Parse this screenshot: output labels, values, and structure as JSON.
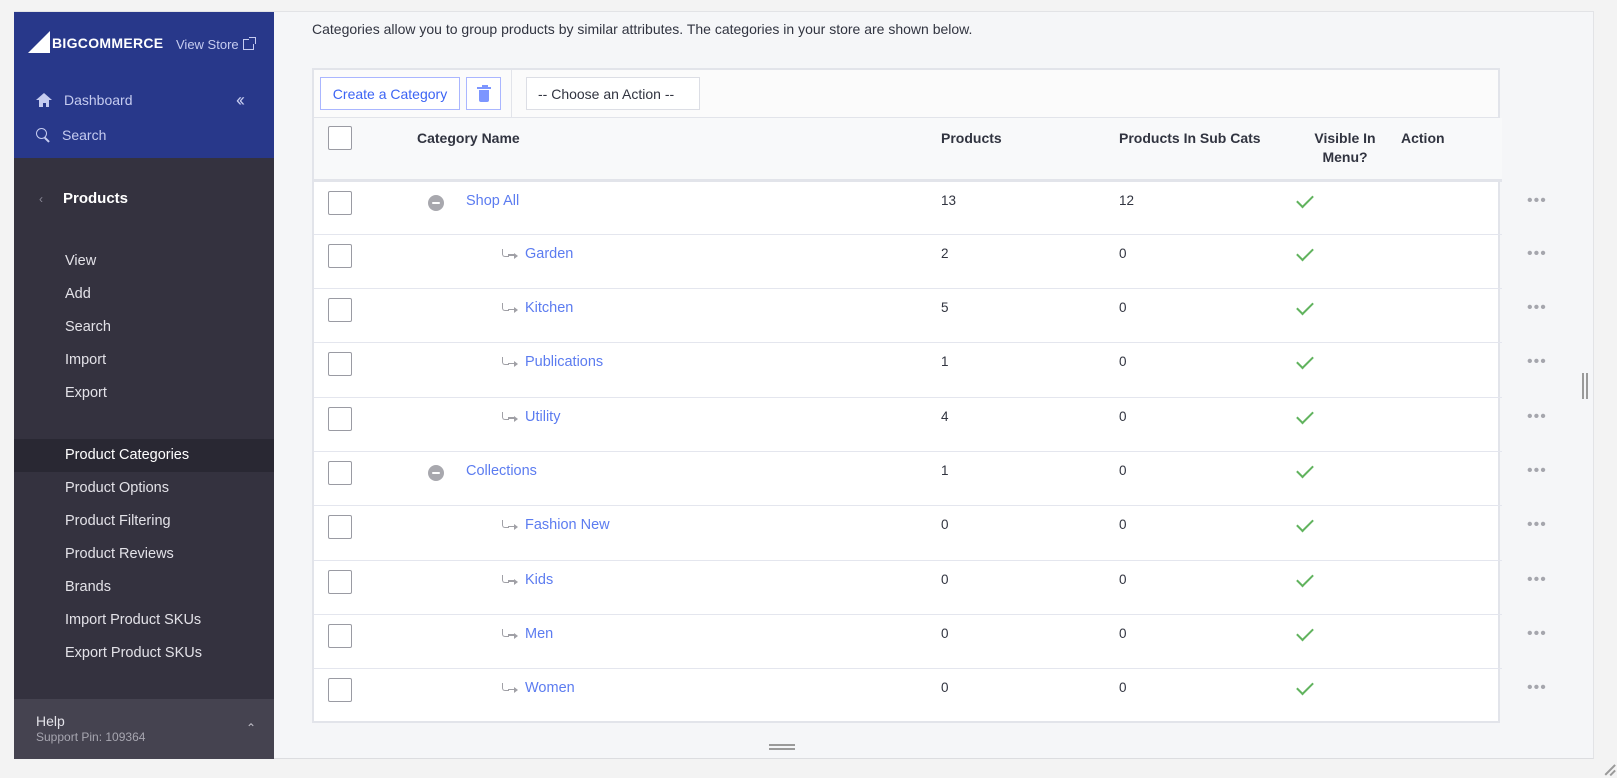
{
  "sidebar": {
    "logo": {
      "big": "BIG",
      "rest": "COMMERCE"
    },
    "view_store": "View Store",
    "dashboard": "Dashboard",
    "search": "Search",
    "section_title": "Products",
    "submenu_a": [
      {
        "label": "View"
      },
      {
        "label": "Add"
      },
      {
        "label": "Search"
      },
      {
        "label": "Import"
      },
      {
        "label": "Export"
      }
    ],
    "submenu_b": [
      {
        "label": "Product Categories",
        "active": true
      },
      {
        "label": "Product Options"
      },
      {
        "label": "Product Filtering"
      },
      {
        "label": "Product Reviews"
      },
      {
        "label": "Brands"
      },
      {
        "label": "Import Product SKUs"
      },
      {
        "label": "Export Product SKUs"
      }
    ],
    "help": {
      "label": "Help",
      "support_pin": "Support Pin: 109364"
    }
  },
  "main": {
    "intro": "Categories allow you to group products by similar attributes. The categories in your store are shown below.",
    "toolbar": {
      "create_label": "Create a Category",
      "action_select": "-- Choose an Action --"
    },
    "table": {
      "headers": {
        "name": "Category Name",
        "products": "Products",
        "sub_cats": "Products In Sub Cats",
        "visible_line1": "Visible In",
        "visible_line2": "Menu?",
        "action": "Action"
      },
      "rows": [
        {
          "name": "Shop All",
          "level": 0,
          "products": "13",
          "sub_cats": "12",
          "visible": true
        },
        {
          "name": "Garden",
          "level": 1,
          "products": "2",
          "sub_cats": "0",
          "visible": true
        },
        {
          "name": "Kitchen",
          "level": 1,
          "products": "5",
          "sub_cats": "0",
          "visible": true
        },
        {
          "name": "Publications",
          "level": 1,
          "products": "1",
          "sub_cats": "0",
          "visible": true
        },
        {
          "name": "Utility",
          "level": 1,
          "products": "4",
          "sub_cats": "0",
          "visible": true
        },
        {
          "name": "Collections",
          "level": 0,
          "products": "1",
          "sub_cats": "0",
          "visible": true
        },
        {
          "name": "Fashion New",
          "level": 1,
          "products": "0",
          "sub_cats": "0",
          "visible": true
        },
        {
          "name": "Kids",
          "level": 1,
          "products": "0",
          "sub_cats": "0",
          "visible": true
        },
        {
          "name": "Men",
          "level": 1,
          "products": "0",
          "sub_cats": "0",
          "visible": true
        },
        {
          "name": "Women",
          "level": 1,
          "products": "0",
          "sub_cats": "0",
          "visible": true
        }
      ]
    }
  },
  "colors": {
    "sidebar_top": "#28388a",
    "sidebar": "#34323f",
    "link": "#5c7cf0",
    "check": "#61b35e"
  }
}
